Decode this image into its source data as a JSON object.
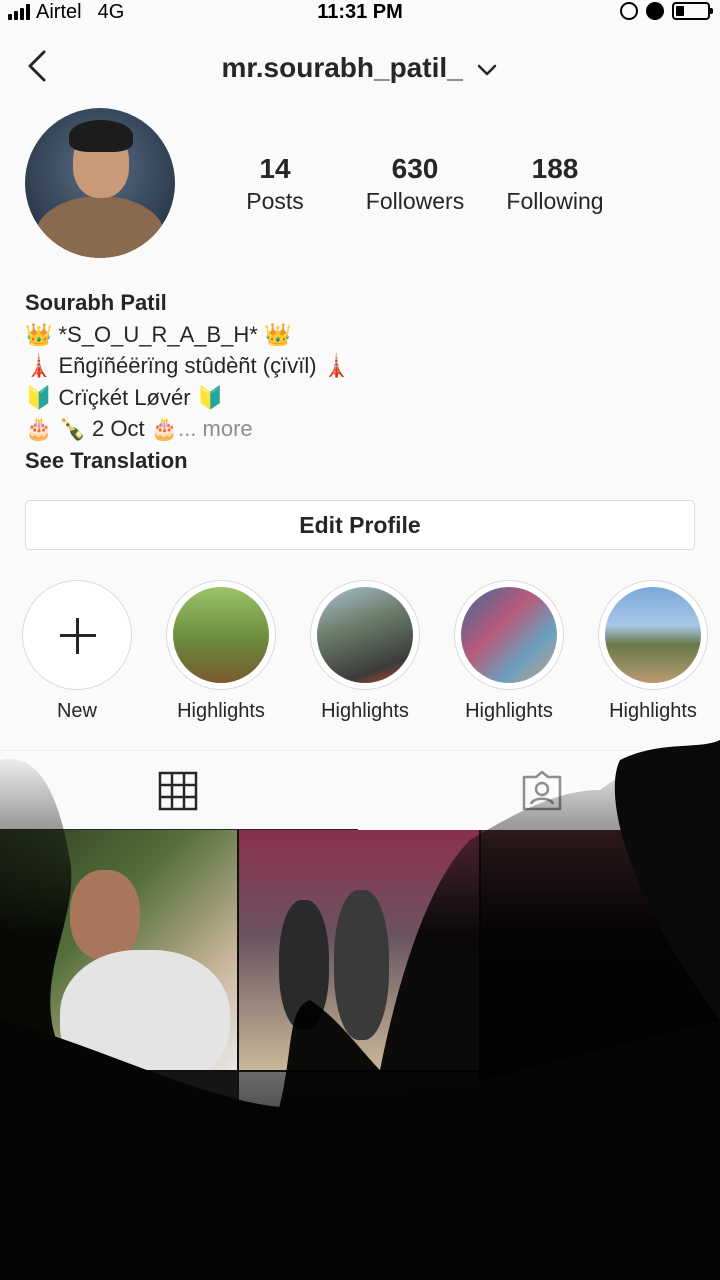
{
  "status_bar": {
    "carrier": "Airtel",
    "network": "4G",
    "time": "11:31 PM"
  },
  "header": {
    "username": "mr.sourabh_patil_"
  },
  "profile": {
    "stats": [
      {
        "value": "14",
        "label": "Posts"
      },
      {
        "value": "630",
        "label": "Followers"
      },
      {
        "value": "188",
        "label": "Following"
      }
    ],
    "name": "Sourabh Patil",
    "bio_lines": [
      "👑 *S_O_U_R_A_B_H* 👑",
      "🗼 Eñgïñéërïng stûdèñt (çïvïl) 🗼",
      "🔰 Crïçkét Løvér 🔰"
    ],
    "bio_last_prefix": "🎂 🍾 2 Oct 🎂",
    "bio_more": "... more",
    "see_translation": "See Translation",
    "edit_profile": "Edit Profile"
  },
  "highlights": [
    {
      "label": "New",
      "icon": "plus-icon"
    },
    {
      "label": "Highlights"
    },
    {
      "label": "Highlights"
    },
    {
      "label": "Highlights"
    },
    {
      "label": "Highlights"
    }
  ],
  "tabs": {
    "grid_icon": "grid-icon",
    "tagged_icon": "tagged-photos-icon"
  },
  "colors": {
    "background": "#fafafa",
    "text": "#262626",
    "muted": "#8e8e8e",
    "border": "#dbdbdb"
  }
}
